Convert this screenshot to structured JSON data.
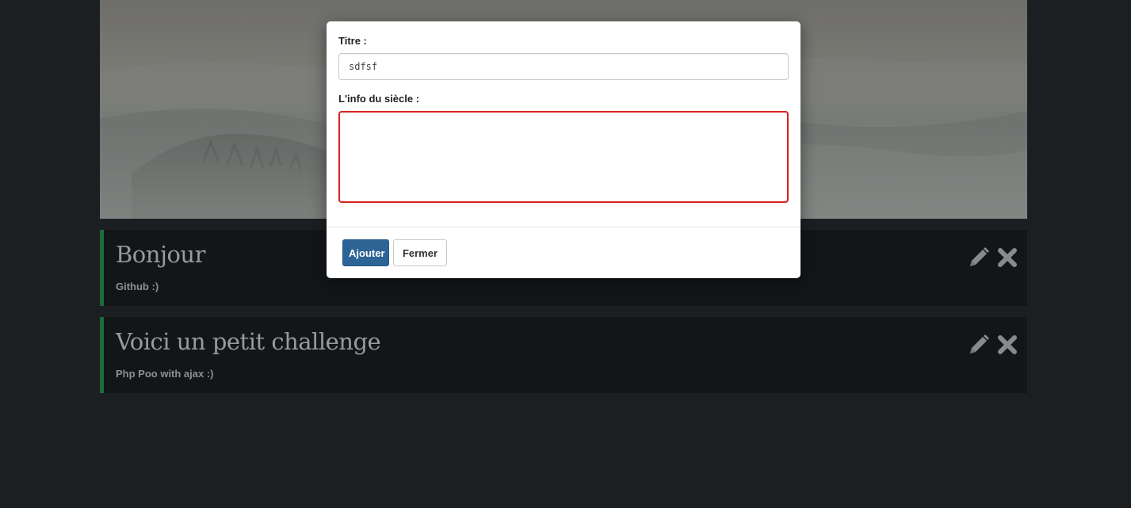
{
  "posts": [
    {
      "title": "Bonjour",
      "subtitle": "Github :)"
    },
    {
      "title": "Voici un petit challenge",
      "subtitle": "Php Poo with ajax :)"
    }
  ],
  "post_actions": {
    "edit_icon": "pencil-icon",
    "delete_icon": "close-icon"
  },
  "modal": {
    "title_label": "Titre :",
    "title_value": "sdfsf",
    "info_label": "L'info du siècle :",
    "info_value": "",
    "add_button": "Ajouter",
    "close_button": "Fermer"
  },
  "colors": {
    "primary": "#2c6496",
    "error_border": "#d9231f",
    "post_accent": "#1d6a3a",
    "page_background": "#1c1f22"
  }
}
